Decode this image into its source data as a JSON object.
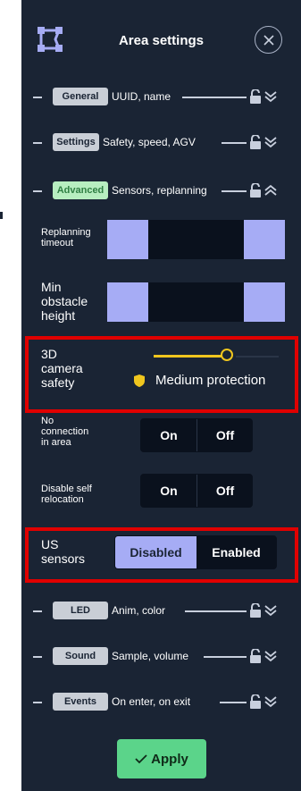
{
  "header": {
    "title": "Area settings"
  },
  "sections": {
    "general": {
      "tag": "General",
      "desc": "UUID, name"
    },
    "settings": {
      "tag": "Settings",
      "desc": "Safety, speed, AGV"
    },
    "advanced": {
      "tag": "Advanced",
      "desc": "Sensors, replanning"
    },
    "led": {
      "tag": "LED",
      "desc": "Anim, color"
    },
    "sound": {
      "tag": "Sound",
      "desc": "Sample, volume"
    },
    "events": {
      "tag": "Events",
      "desc": "On enter, on exit"
    }
  },
  "advanced": {
    "replanning_label_1": "Replanning",
    "replanning_label_2": "timeout",
    "min_obstacle_label_1": "Min",
    "min_obstacle_label_2": "obstacle",
    "min_obstacle_label_3": "height",
    "camera_label_1": "3D",
    "camera_label_2": "camera",
    "camera_label_3": "safety",
    "camera_protection": "Medium protection",
    "camera_slider_level": 0.67,
    "no_conn_label_1": "No",
    "no_conn_label_2": "connection",
    "no_conn_label_3": "in area",
    "no_conn_on": "On",
    "no_conn_off": "Off",
    "disable_reloc_label_1": "Disable self",
    "disable_reloc_label_2": "relocation",
    "disable_reloc_on": "On",
    "disable_reloc_off": "Off",
    "us_label_1": "US",
    "us_label_2": "sensors",
    "us_disabled": "Disabled",
    "us_enabled": "Enabled",
    "us_selected": "Disabled"
  },
  "footer": {
    "apply_label": "Apply"
  },
  "colors": {
    "panel": "#1a2434",
    "accent": "#a6acf5",
    "slider": "#f0c61e",
    "apply": "#5bd48a",
    "highlight": "#e00000"
  }
}
